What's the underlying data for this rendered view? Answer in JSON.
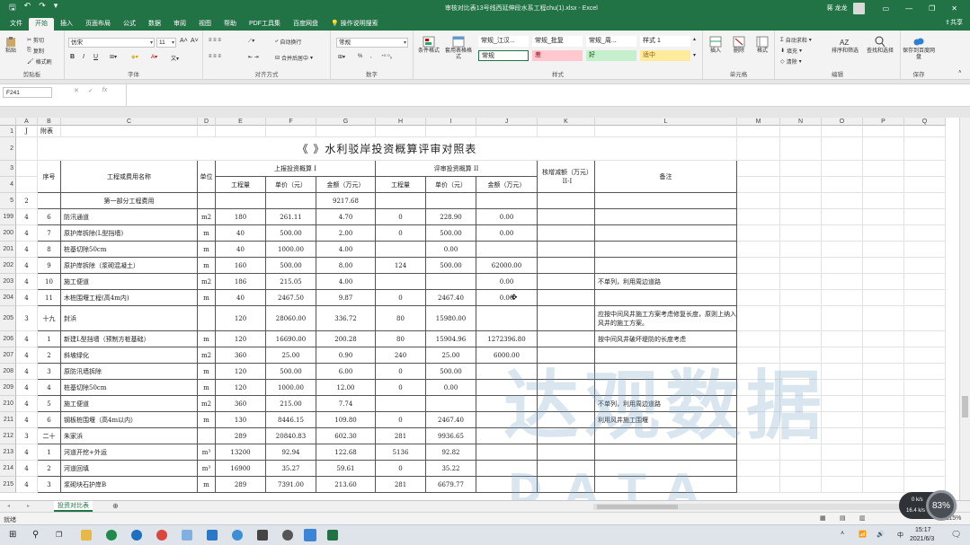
{
  "titlebar": {
    "filename": "审核对比表13号线西延伸段水系工程chu(1).xlsx  -  Excel",
    "user": "蒋 龙龙"
  },
  "tabs": [
    {
      "label": "文件"
    },
    {
      "label": "开始"
    },
    {
      "label": "插入"
    },
    {
      "label": "页面布局"
    },
    {
      "label": "公式"
    },
    {
      "label": "数据"
    },
    {
      "label": "审阅"
    },
    {
      "label": "视图"
    },
    {
      "label": "帮助"
    },
    {
      "label": "PDF工具集"
    },
    {
      "label": "百度网盘"
    },
    {
      "label": "操作说明搜索"
    }
  ],
  "share_label": "共享",
  "ribbon": {
    "clipboard": {
      "label": "剪贴板",
      "paste": "粘贴",
      "cut": "剪切",
      "copy": "复制",
      "format_painter": "格式刷"
    },
    "font": {
      "label": "字体",
      "name": "仿宋",
      "size": "11",
      "bold": "B",
      "italic": "I",
      "underline": "U"
    },
    "align": {
      "label": "对齐方式",
      "wrap": "自动换行",
      "merge": "合并后居中"
    },
    "number": {
      "label": "数字",
      "format": "常规",
      "percent": "%"
    },
    "styles": {
      "label": "样式",
      "cond": "条件格式",
      "table": "套用表格格式",
      "cells": [
        {
          "name": "常规_江汉...",
          "color": "#ffffff"
        },
        {
          "name": "常规_批复",
          "color": "#ffffff"
        },
        {
          "name": "常规_周...",
          "color": "#ffffff"
        },
        {
          "name": "样式 1",
          "color": "#ffffff"
        },
        {
          "name": "常规",
          "color": "#ffffff"
        },
        {
          "name": "差",
          "color": "#ffc7ce"
        },
        {
          "name": "好",
          "color": "#c6efce"
        },
        {
          "name": "适中",
          "color": "#ffeb9c"
        }
      ]
    },
    "cells_group": {
      "label": "单元格",
      "insert": "插入",
      "delete": "删除",
      "format": "格式"
    },
    "edit": {
      "label": "编辑",
      "autosum": "自动求和",
      "fill": "填充",
      "clear": "清除",
      "sort": "排序和筛选",
      "find": "查找和选择"
    },
    "save": {
      "label": "保存",
      "save_to": "保存到百度网盘"
    }
  },
  "namebox": "F241",
  "col_letters": [
    "A",
    "B",
    "C",
    "D",
    "E",
    "F",
    "G",
    "H",
    "I",
    "J",
    "K",
    "L",
    "M",
    "N",
    "O",
    "P",
    "Q"
  ],
  "title_text": "《                                      》水利驳岸投资概算评审对照表",
  "headers": {
    "a1": "J",
    "b1": "附表",
    "seq": "序号",
    "name": "工程或费用名称",
    "unit": "单位",
    "reported": "上报投资概算 I",
    "reviewed": "评审投资概算 II",
    "delta": "核增减额（万元）II-I",
    "remark": "备注",
    "qty": "工程量",
    "price": "单价（元）",
    "amount": "金额（万元）"
  },
  "row5": {
    "a": "2",
    "c": "第一部分工程费用",
    "g": "9217.68"
  },
  "rows": [
    {
      "r": "199",
      "a": "4",
      "b": "6",
      "c": "防汛通道",
      "d": "m2",
      "e": "180",
      "f": "261.11",
      "g": "4.70",
      "h": "0",
      "i": "228.90",
      "j": "0.00",
      "l": ""
    },
    {
      "r": "200",
      "a": "4",
      "b": "7",
      "c": "原护岸拆除(L型挡墙)",
      "d": "m",
      "e": "40",
      "f": "500.00",
      "g": "2.00",
      "h": "0",
      "i": "500.00",
      "j": "0.00",
      "l": ""
    },
    {
      "r": "201",
      "a": "4",
      "b": "8",
      "c": "桩基切除50cm",
      "d": "m",
      "e": "40",
      "f": "1000.00",
      "g": "4.00",
      "h": "",
      "i": "0.00",
      "j": "",
      "l": ""
    },
    {
      "r": "202",
      "a": "4",
      "b": "9",
      "c": "原护岸拆除（浆砌混凝土）",
      "d": "m",
      "e": "160",
      "f": "500.00",
      "g": "8.00",
      "h": "124",
      "i": "500.00",
      "j": "62000.00",
      "l": ""
    },
    {
      "r": "203",
      "a": "4",
      "b": "10",
      "c": "施工便道",
      "d": "m2",
      "e": "186",
      "f": "215.05",
      "g": "4.00",
      "h": "",
      "i": "",
      "j": "0.00",
      "l": "不单列，利用周边道路"
    },
    {
      "r": "204",
      "a": "4",
      "b": "11",
      "c": "木桩围堰工程(高4m内)",
      "d": "m",
      "e": "40",
      "f": "2467.50",
      "g": "9.87",
      "h": "0",
      "i": "2467.40",
      "j": "0.00",
      "l": ""
    },
    {
      "r": "205",
      "a": "3",
      "b": "十九",
      "c": "封浜",
      "d": "",
      "e": "120",
      "f": "28060.00",
      "g": "336.72",
      "h": "80",
      "i": "15980.00",
      "j": "",
      "l": "应按中间风井施工方案考虑修复长度，原则上纳入风井的施工方案。"
    },
    {
      "r": "206",
      "a": "4",
      "b": "1",
      "c": "新建L型挡墙（预制方桩基础）",
      "d": "m",
      "e": "120",
      "f": "16690.00",
      "g": "200.28",
      "h": "80",
      "i": "15904.96",
      "j": "1272396.80",
      "l": "按中间风井破坏堤防的长度考虑"
    },
    {
      "r": "207",
      "a": "4",
      "b": "2",
      "c": "斜坡绿化",
      "d": "m2",
      "e": "360",
      "f": "25.00",
      "g": "0.90",
      "h": "240",
      "i": "25.00",
      "j": "6000.00",
      "l": ""
    },
    {
      "r": "208",
      "a": "4",
      "b": "3",
      "c": "原防汛墙拆除",
      "d": "m",
      "e": "120",
      "f": "500.00",
      "g": "6.00",
      "h": "0",
      "i": "500.00",
      "j": "",
      "l": ""
    },
    {
      "r": "209",
      "a": "4",
      "b": "4",
      "c": "桩基切除50cm",
      "d": "m",
      "e": "120",
      "f": "1000.00",
      "g": "12.00",
      "h": "0",
      "i": "0.00",
      "j": "",
      "l": ""
    },
    {
      "r": "210",
      "a": "4",
      "b": "5",
      "c": "施工便道",
      "d": "m2",
      "e": "360",
      "f": "215.00",
      "g": "7.74",
      "h": "",
      "i": "",
      "j": "",
      "l": "不单列，利用周边道路"
    },
    {
      "r": "211",
      "a": "4",
      "b": "6",
      "c": "钢板桩围堰（高4m以内）",
      "d": "m",
      "e": "130",
      "f": "8446.15",
      "g": "109.80",
      "h": "0",
      "i": "2467.40",
      "j": "",
      "l": "利用风井施工围堰"
    },
    {
      "r": "212",
      "a": "3",
      "b": "二十",
      "c": "朱家浜",
      "d": "",
      "e": "289",
      "f": "20840.83",
      "g": "602.30",
      "h": "281",
      "i": "9936.65",
      "j": "",
      "l": ""
    },
    {
      "r": "213",
      "a": "4",
      "b": "1",
      "c": "河道开挖+外运",
      "d": "m³",
      "e": "13200",
      "f": "92.94",
      "g": "122.68",
      "h": "5136",
      "i": "92.82",
      "j": "",
      "l": ""
    },
    {
      "r": "214",
      "a": "4",
      "b": "2",
      "c": "河道回填",
      "d": "m³",
      "e": "16900",
      "f": "35.27",
      "g": "59.61",
      "h": "0",
      "i": "35.22",
      "j": "",
      "l": ""
    },
    {
      "r": "215",
      "a": "4",
      "b": "3",
      "c": "浆砌块石护岸B",
      "d": "m",
      "e": "289",
      "f": "7391.00",
      "g": "213.60",
      "h": "281",
      "i": "6679.77",
      "j": "",
      "l": ""
    }
  ],
  "sheet_tab": "投资对比表",
  "status": {
    "ready": "就绪",
    "zoom": "115%"
  },
  "clock": {
    "time": "15:17",
    "date": "2021/6/3",
    "ime": "中"
  },
  "network": {
    "up": "0 k/s",
    "down": "16.4 k/s",
    "pct": "83%"
  },
  "watermark": {
    "cn": "达观数据",
    "en": "DATA GRAND"
  }
}
